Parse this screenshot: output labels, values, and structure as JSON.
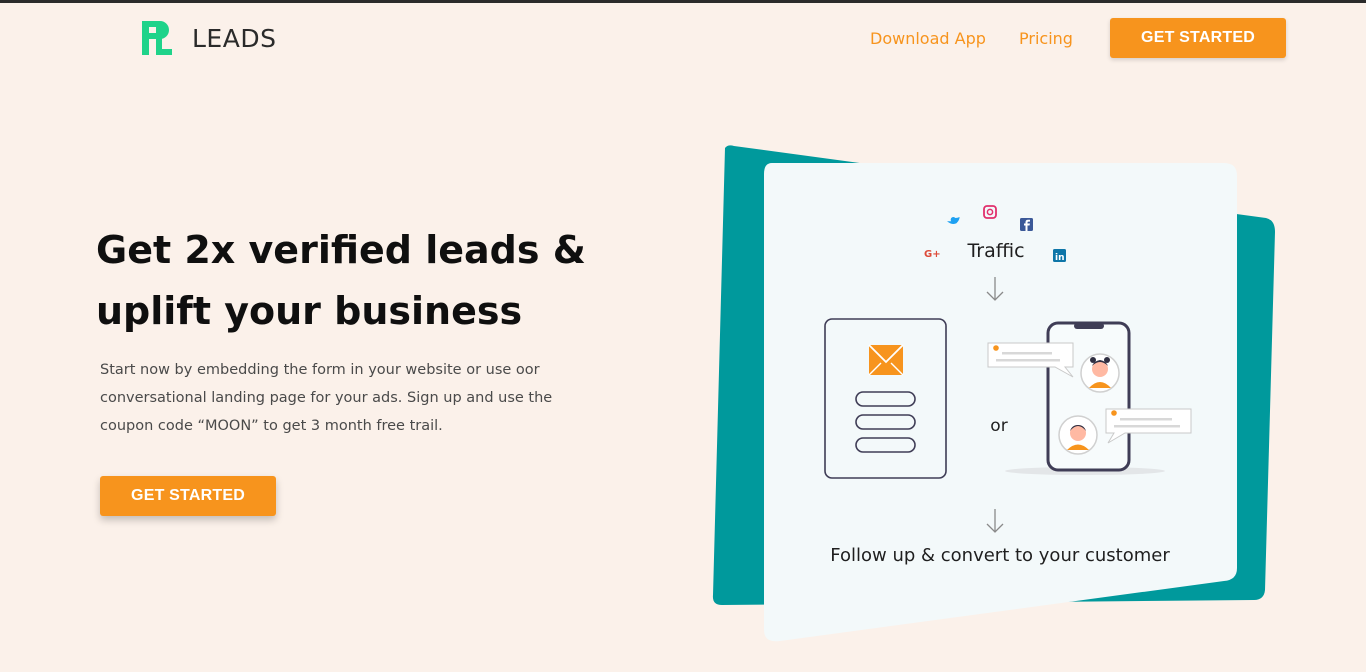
{
  "brand": {
    "logo_text": "LEADS",
    "accent": "#1fd38a"
  },
  "nav": {
    "download_label": "Download App",
    "pricing_label": "Pricing",
    "cta_label": "GET STARTED"
  },
  "hero": {
    "headline_line1": "Get 2x verified leads &",
    "headline_line2": "uplift your business",
    "description": "Start now by embedding the form in your website or use oor conversational landing page for your ads. Sign up and use the coupon code “MOON” to get 3 month free trail.",
    "cta_label": "GET STARTED"
  },
  "illustration": {
    "traffic_label": "Traffic",
    "or_label": "or",
    "bottom_label": "Follow up & convert to your customer",
    "icons": [
      "twitter-icon",
      "instagram-icon",
      "facebook-icon",
      "google-plus-icon",
      "linkedin-icon",
      "mail-icon"
    ]
  },
  "colors": {
    "background": "#fbf1ea",
    "orange": "#f7941d",
    "teal": "#00999c",
    "dark": "#0f0f0f"
  }
}
